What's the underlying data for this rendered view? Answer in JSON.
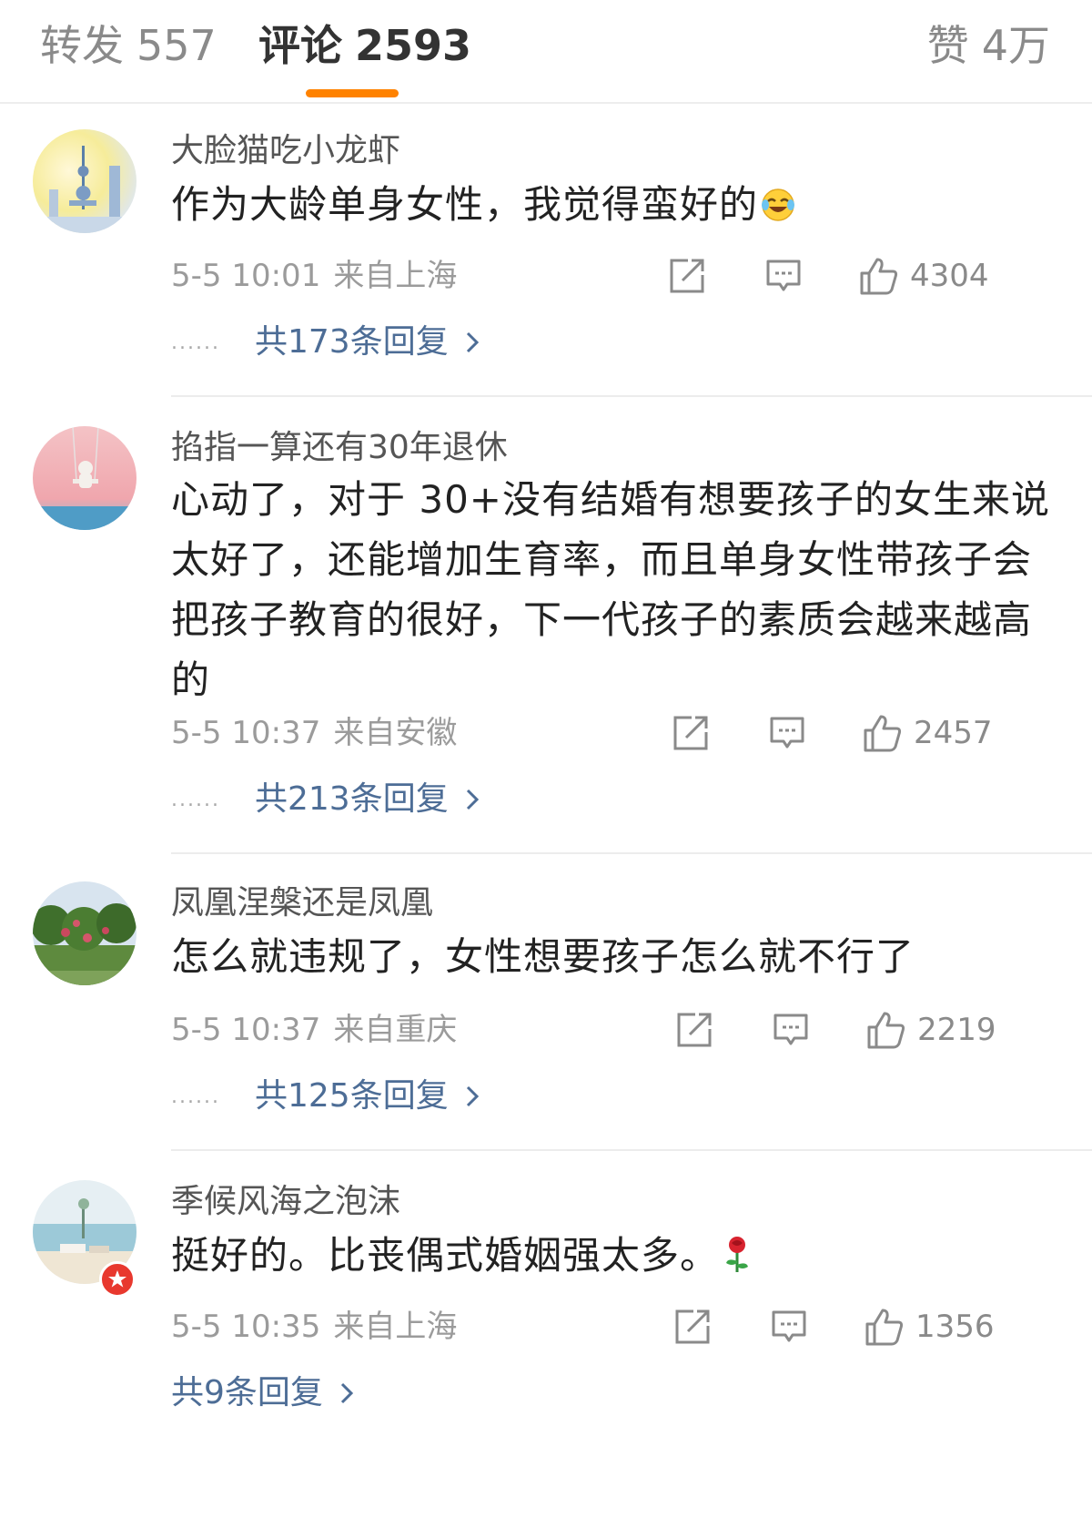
{
  "tabs": {
    "repost": {
      "label": "转发",
      "count": "557"
    },
    "comment": {
      "label": "评论",
      "count": "2593"
    },
    "like": {
      "label": "赞",
      "count": "4万"
    }
  },
  "colors": {
    "accent": "#ff8200",
    "link": "#4d6d96",
    "meta": "#9b9b9b"
  },
  "comments": [
    {
      "username": "大脸猫吃小龙虾",
      "text": "作为大龄单身女性，我觉得蛮好的",
      "emoji": "laughing-tears-emoji",
      "date": "5-5 10:01",
      "location": "来自上海",
      "likes": "4304",
      "replies": "共173条回复"
    },
    {
      "username": "掐指一算还有30年退休",
      "text": "心动了，对于 30+没有结婚有想要孩子的女生来说太好了，还能增加生育率，而且单身女性带孩子会把孩子教育的很好，下一代孩子的素质会越来越高的",
      "date": "5-5 10:37",
      "location": "来自安徽",
      "likes": "2457",
      "replies": "共213条回复"
    },
    {
      "username": "凤凰涅槃还是凤凰",
      "text": "怎么就违规了，女性想要孩子怎么就不行了",
      "date": "5-5 10:37",
      "location": "来自重庆",
      "likes": "2219",
      "replies": "共125条回复"
    },
    {
      "username": "季候风海之泡沫",
      "text": "挺好的。比丧偶式婚姻强太多。",
      "emoji": "rose-emoji",
      "date": "5-5 10:35",
      "location": "来自上海",
      "likes": "1356",
      "replies": "共9条回复"
    }
  ],
  "icons": [
    "repost-icon",
    "comment-icon",
    "thumbs-up-icon",
    "chevron-right-icon"
  ]
}
